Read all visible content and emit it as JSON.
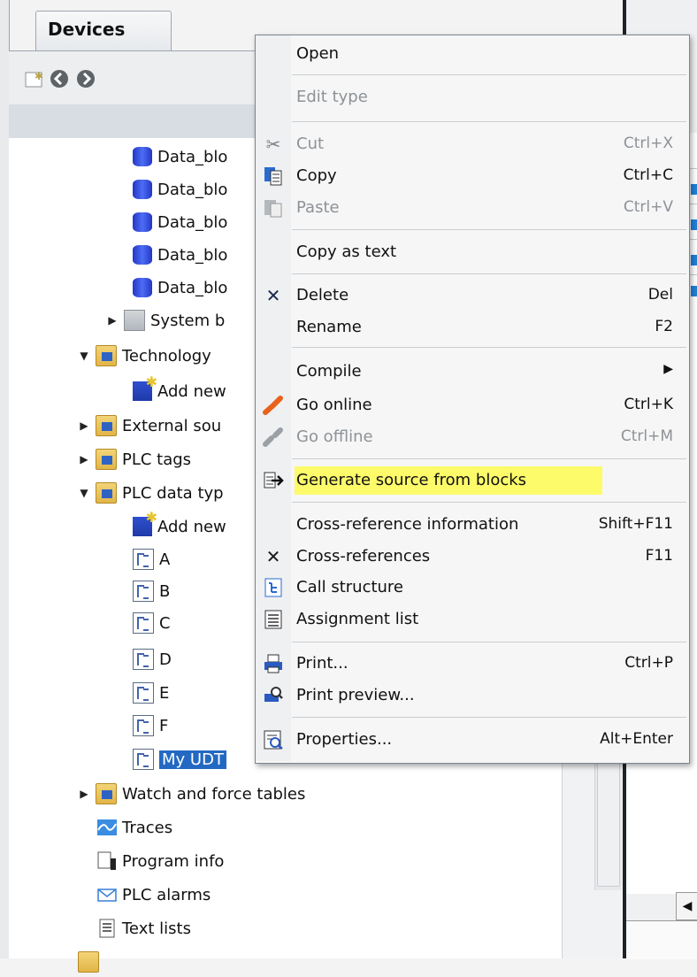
{
  "tabs": {
    "devices": "Devices"
  },
  "toolbar": [
    {
      "icon": "new-window-icon"
    },
    {
      "icon": "back-icon"
    },
    {
      "icon": "forward-icon"
    }
  ],
  "tree": {
    "rows": [
      {
        "label": "Data_blo",
        "icon": "db-icon"
      },
      {
        "label": "Data_blo",
        "icon": "db-icon"
      },
      {
        "label": "Data_blo",
        "icon": "db-icon"
      },
      {
        "label": "Data_blo",
        "icon": "db-icon"
      },
      {
        "label": "Data_blo",
        "icon": "db-icon"
      },
      {
        "label": "System b",
        "icon": "system-folder-icon",
        "twisty": "▶"
      },
      {
        "label": "Technology",
        "icon": "technology-folder-icon",
        "twisty": "▼"
      },
      {
        "label": "Add new",
        "icon": "add-new-icon"
      },
      {
        "label": "External sou",
        "icon": "external-folder-icon",
        "twisty": "▶"
      },
      {
        "label": "PLC tags",
        "icon": "plc-tags-folder-icon",
        "twisty": "▶"
      },
      {
        "label": "PLC data typ",
        "icon": "plc-datatypes-folder-icon",
        "twisty": "▼"
      },
      {
        "label": "Add new",
        "icon": "add-new-icon"
      },
      {
        "label": "A",
        "icon": "udt-icon"
      },
      {
        "label": "B",
        "icon": "udt-icon"
      },
      {
        "label": "C",
        "icon": "udt-icon"
      },
      {
        "label": "D",
        "icon": "udt-icon"
      },
      {
        "label": "E",
        "icon": "udt-icon"
      },
      {
        "label": "F",
        "icon": "udt-icon"
      },
      {
        "label": "My UDT",
        "icon": "udt-icon",
        "selected": true
      },
      {
        "label": "Watch and force tables",
        "icon": "watch-tables-folder-icon",
        "twisty": "▶"
      },
      {
        "label": "Traces",
        "icon": "traces-icon"
      },
      {
        "label": "Program info",
        "icon": "program-info-icon"
      },
      {
        "label": "PLC alarms",
        "icon": "alarms-icon"
      },
      {
        "label": "Text lists",
        "icon": "text-lists-icon"
      }
    ]
  },
  "context_menu": {
    "items": [
      {
        "label": "Open",
        "shortcut": "",
        "enabled": true,
        "icon": ""
      },
      {
        "label": "Edit type",
        "shortcut": "",
        "enabled": false,
        "icon": ""
      },
      {
        "label": "Cut",
        "shortcut": "Ctrl+X",
        "enabled": false,
        "icon": "cut-icon"
      },
      {
        "label": "Copy",
        "shortcut": "Ctrl+C",
        "enabled": true,
        "icon": "copy-icon"
      },
      {
        "label": "Paste",
        "shortcut": "Ctrl+V",
        "enabled": false,
        "icon": "paste-icon"
      },
      {
        "label": "Copy as text",
        "shortcut": "",
        "enabled": true,
        "icon": ""
      },
      {
        "label": "Delete",
        "shortcut": "Del",
        "enabled": true,
        "icon": "delete-icon"
      },
      {
        "label": "Rename",
        "shortcut": "F2",
        "enabled": true,
        "icon": ""
      },
      {
        "label": "Compile",
        "shortcut": "▶",
        "enabled": true,
        "icon": ""
      },
      {
        "label": "Go online",
        "shortcut": "Ctrl+K",
        "enabled": true,
        "icon": "go-online-icon"
      },
      {
        "label": "Go offline",
        "shortcut": "Ctrl+M",
        "enabled": false,
        "icon": "go-offline-icon"
      },
      {
        "label": "Generate source from blocks",
        "shortcut": "",
        "enabled": true,
        "icon": "generate-source-icon",
        "highlighted": true
      },
      {
        "label": "Cross-reference information",
        "shortcut": "Shift+F11",
        "enabled": true,
        "icon": ""
      },
      {
        "label": "Cross-references",
        "shortcut": "F11",
        "enabled": true,
        "icon": "cross-references-icon"
      },
      {
        "label": "Call structure",
        "shortcut": "",
        "enabled": true,
        "icon": "call-structure-icon"
      },
      {
        "label": "Assignment list",
        "shortcut": "",
        "enabled": true,
        "icon": "assignment-list-icon"
      },
      {
        "label": "Print...",
        "shortcut": "Ctrl+P",
        "enabled": true,
        "icon": "print-icon"
      },
      {
        "label": "Print preview...",
        "shortcut": "",
        "enabled": true,
        "icon": "print-preview-icon"
      },
      {
        "label": "Properties...",
        "shortcut": "Alt+Enter",
        "enabled": true,
        "icon": "properties-icon"
      }
    ]
  },
  "colors": {
    "highlight": "#fdfb6a",
    "selection": "#2369c3",
    "accent": "#1f7fd8"
  }
}
